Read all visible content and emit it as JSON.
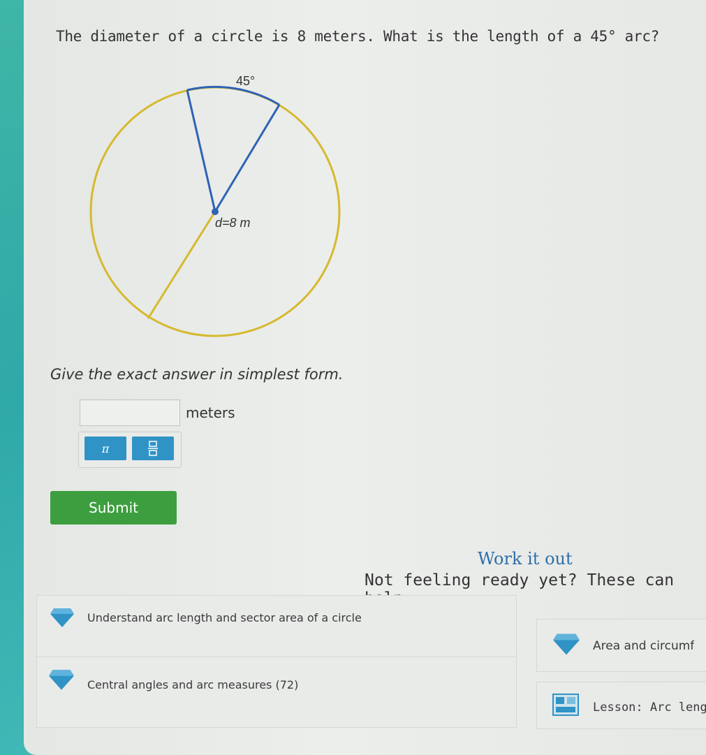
{
  "question": "The diameter of a circle is 8 meters. What is the length of a 45° arc?",
  "diagram": {
    "angle_label": "45°",
    "diameter_label": "d=8 m",
    "colors": {
      "circle": "#d6b92e",
      "radius": "#2f63b5",
      "center": "#2f63b5"
    }
  },
  "instruction": "Give the exact answer in simplest form.",
  "answer": {
    "value": "",
    "unit": "meters"
  },
  "tools": {
    "pi_label": "π",
    "fraction_icon": "fraction-icon"
  },
  "submit_label": "Submit",
  "work_it_out": "Work it out",
  "help_header": "Not feeling ready yet? These can help:",
  "help_items": [
    {
      "label": "Understand arc length and sector area of a circle",
      "icon": "diamond-icon"
    },
    {
      "label": "Area and circumf",
      "icon": "diamond-icon"
    },
    {
      "label": "Central angles and arc measures (72)",
      "icon": "diamond-icon"
    },
    {
      "label": "Lesson: Arc lengt",
      "icon": "lesson-icon"
    }
  ],
  "colors": {
    "accent_blue": "#2f93c6",
    "submit_green": "#3d9e3f",
    "link_blue": "#2f6fa8"
  }
}
